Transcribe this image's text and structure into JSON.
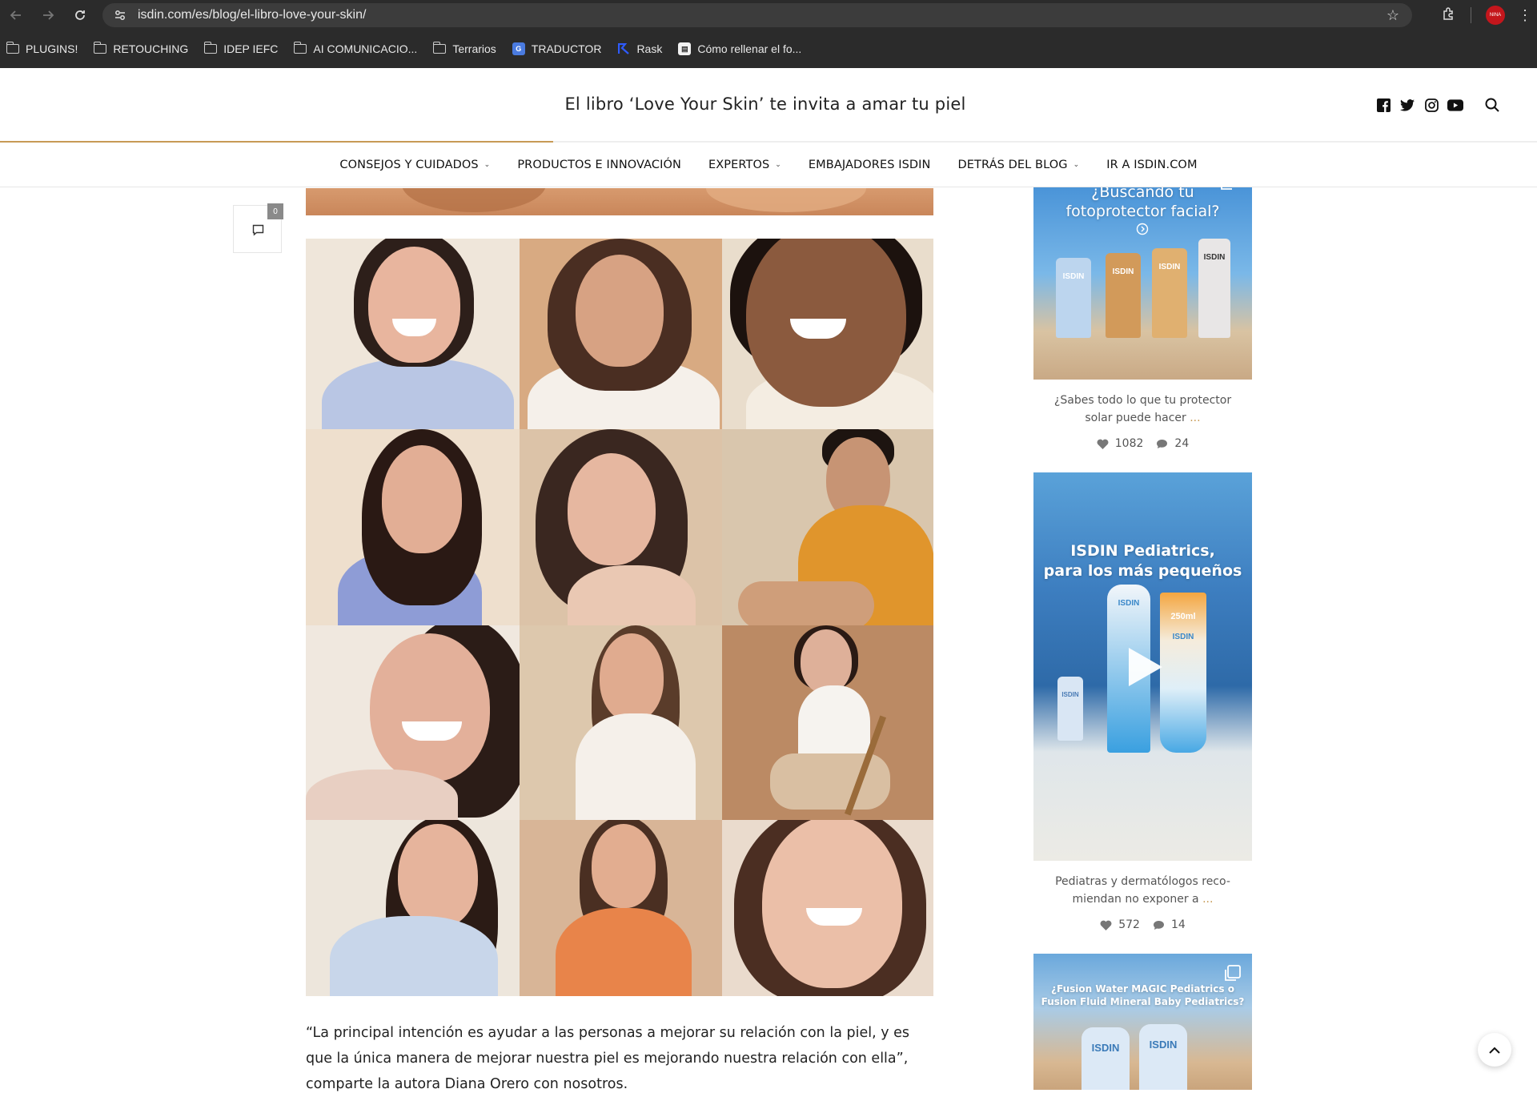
{
  "browser": {
    "url": "isdin.com/es/blog/el-libro-love-your-skin/",
    "bookmarks": [
      {
        "label": "PLUGINS!",
        "type": "folder"
      },
      {
        "label": "RETOUCHING",
        "type": "folder"
      },
      {
        "label": "IDEP IEFC",
        "type": "folder"
      },
      {
        "label": "AI COMUNICACIO...",
        "type": "folder"
      },
      {
        "label": "Terrarios",
        "type": "folder"
      },
      {
        "label": "TRADUCTOR",
        "type": "translate"
      },
      {
        "label": "Rask",
        "type": "rask"
      },
      {
        "label": "Cómo rellenar el fo...",
        "type": "page"
      }
    ],
    "profile_badge": "NINA"
  },
  "header": {
    "title": "El libro ‘Love Your Skin’ te invita a amar tu piel",
    "social": [
      "facebook-icon",
      "twitter-icon",
      "instagram-icon",
      "youtube-icon"
    ],
    "reading_progress": 0.36,
    "accent": "#c79a55"
  },
  "nav": {
    "items": [
      {
        "label": "CONSEJOS Y CUIDADOS",
        "dropdown": true
      },
      {
        "label": "PRODUCTOS E INNOVACIÓN",
        "dropdown": false
      },
      {
        "label": "EXPERTOS",
        "dropdown": true
      },
      {
        "label": "EMBAJADORES ISDIN",
        "dropdown": false
      },
      {
        "label": "DETRÁS DEL BLOG",
        "dropdown": true
      },
      {
        "label": "IR A ISDIN.COM",
        "dropdown": false
      }
    ]
  },
  "comments": {
    "count": "0"
  },
  "article": {
    "paragraph": "“La principal intención es ayudar a las personas a mejorar su relación con la piel, y es que la única manera de mejorar nuestra piel es mejorando nuestra relación con ella”, comparte la autora Diana Orero con nosotros."
  },
  "sidebar": {
    "posts": [
      {
        "promo_line1": "¿Buscando tu",
        "promo_line2": "fotoprotector facial?",
        "bottle_brand": "ISDIN",
        "caption_line1": "¿Sabes todo lo que tu protector",
        "caption_line2": "solar puede hacer",
        "more": " ...",
        "likes": "1082",
        "comments": "24"
      },
      {
        "promo_line1": "ISDIN Pediatrics,",
        "promo_line2": "para los más pequeños",
        "tube_size": "250ml",
        "bottle_brand": "ISDIN",
        "caption_line1": "Pediatras y dermatólogos reco-",
        "caption_line2": "miendan no exponer a",
        "more": " ...",
        "likes": "572",
        "comments": "14"
      },
      {
        "promo_line1": "¿Fusion Water MAGIC Pediatrics o",
        "promo_line2": "Fusion Fluid Mineral Baby Pediatrics?",
        "bottle_brand": "ISDIN"
      }
    ]
  }
}
